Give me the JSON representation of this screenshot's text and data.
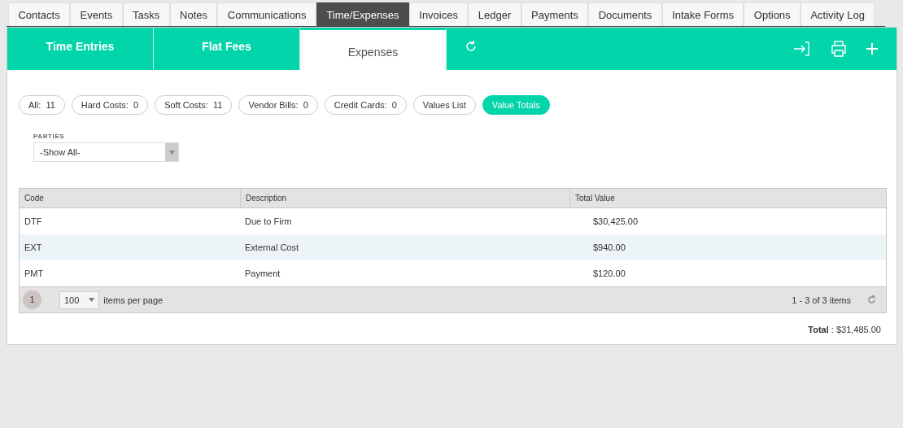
{
  "tabs": [
    {
      "label": "Contacts",
      "selected": false
    },
    {
      "label": "Events",
      "selected": false
    },
    {
      "label": "Tasks",
      "selected": false
    },
    {
      "label": "Notes",
      "selected": false
    },
    {
      "label": "Communications",
      "selected": false
    },
    {
      "label": "Time/Expenses",
      "selected": true
    },
    {
      "label": "Invoices",
      "selected": false
    },
    {
      "label": "Ledger",
      "selected": false
    },
    {
      "label": "Payments",
      "selected": false
    },
    {
      "label": "Documents",
      "selected": false
    },
    {
      "label": "Intake Forms",
      "selected": false
    },
    {
      "label": "Options",
      "selected": false
    },
    {
      "label": "Activity Log",
      "selected": false
    }
  ],
  "subtabs": [
    {
      "label": "Time Entries",
      "selected": false
    },
    {
      "label": "Flat Fees",
      "selected": false
    },
    {
      "label": "Expenses",
      "selected": true
    }
  ],
  "filters": [
    {
      "label": "All:  11",
      "selected": false
    },
    {
      "label": "Hard Costs:  0",
      "selected": false
    },
    {
      "label": "Soft Costs:  11",
      "selected": false
    },
    {
      "label": "Vendor Bills:  0",
      "selected": false
    },
    {
      "label": "Credit Cards:  0",
      "selected": false
    },
    {
      "label": "Values List",
      "selected": false
    },
    {
      "label": "Value Totals",
      "selected": true
    }
  ],
  "parties": {
    "label": "PARTIES",
    "value": "-Show All-"
  },
  "table": {
    "columns": [
      "Code",
      "Description",
      "Total Value"
    ],
    "rows": [
      {
        "cells": [
          "DTF",
          "Due to Firm",
          "$30,425.00"
        ],
        "selected": false
      },
      {
        "cells": [
          "EXT",
          "External Cost",
          "$940.00"
        ],
        "selected": true
      },
      {
        "cells": [
          "PMT",
          "Payment",
          "$120.00"
        ],
        "selected": false
      }
    ]
  },
  "pager": {
    "page": "1",
    "page_size": "100",
    "page_size_label": "items per page",
    "range": "1 - 3 of 3 items"
  },
  "total": "**Total** : $31,485.00"
}
